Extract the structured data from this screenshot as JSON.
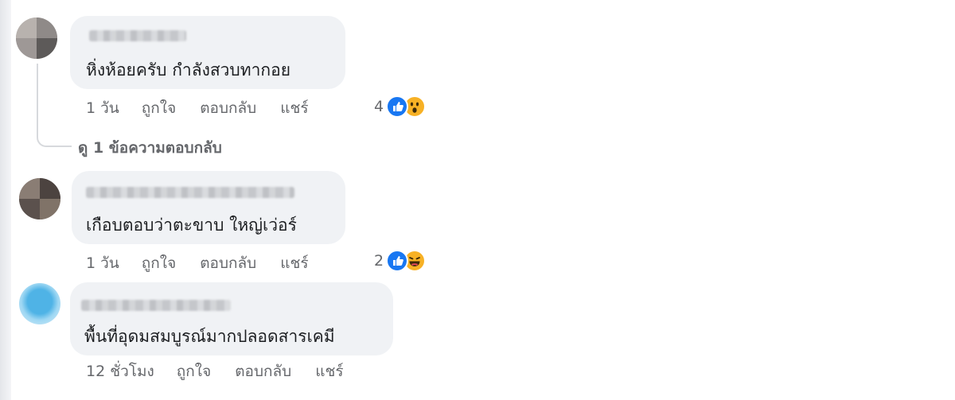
{
  "comments": [
    {
      "text": "หิ่งห้อยครับ กำลังสวบทากอย",
      "time": "1 วัน",
      "like": "ถูกใจ",
      "reply": "ตอบกลับ",
      "share": "แชร์",
      "reaction_count": "4",
      "reaction_icons": [
        "like-icon",
        "wow-icon"
      ]
    },
    {
      "text": "เกือบตอบว่าตะขาบ ใหญ่เว่อร์",
      "time": "1 วัน",
      "like": "ถูกใจ",
      "reply": "ตอบกลับ",
      "share": "แชร์",
      "reaction_count": "2",
      "reaction_icons": [
        "like-icon",
        "haha-icon"
      ]
    },
    {
      "text": "พื้นที่อุดมสมบูรณ์มากปลอดสารเคมี",
      "time": "12 ชั่วโมง",
      "like": "ถูกใจ",
      "reply": "ตอบกลับ",
      "share": "แชร์"
    }
  ],
  "view_replies": "ดู 1 ข้อความตอบกลับ",
  "colors": {
    "bubble": "#f0f2f5",
    "meta_text": "#65676b",
    "like_blue": "#1877f2",
    "emoji_yellow": "#f7b125"
  }
}
